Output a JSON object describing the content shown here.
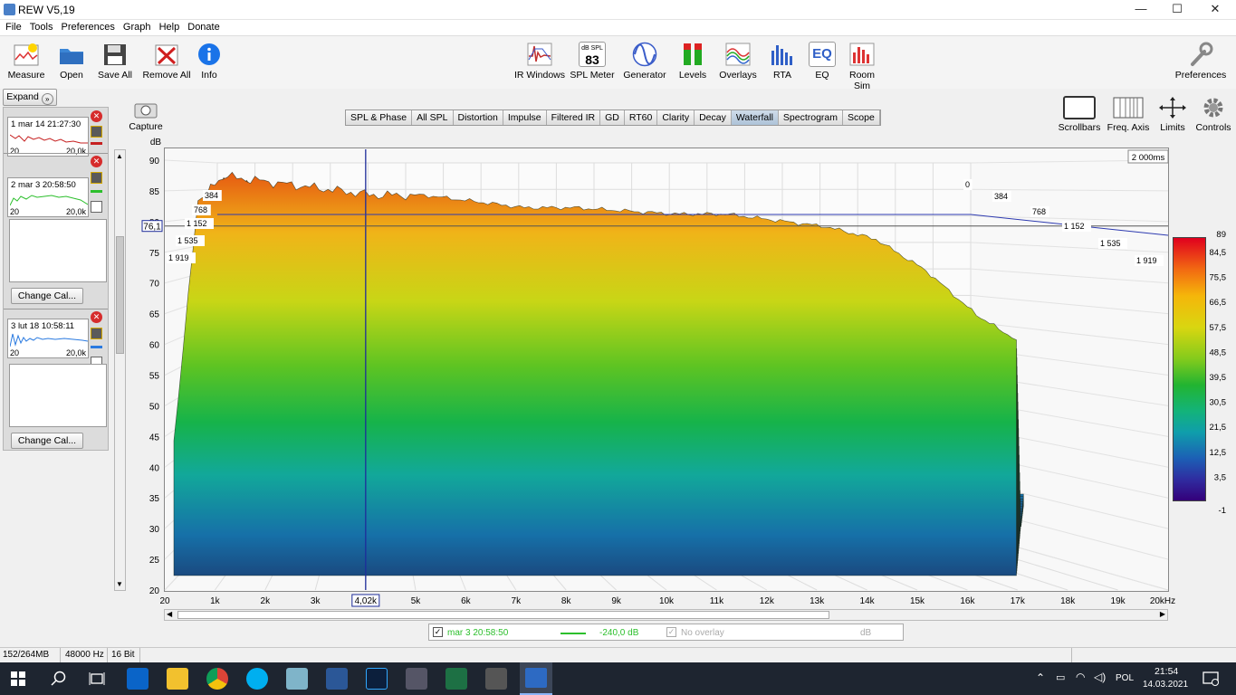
{
  "window": {
    "title": "REW V5,19",
    "minimize": "—",
    "maximize": "☐",
    "close": "✕"
  },
  "menu": [
    "File",
    "Tools",
    "Preferences",
    "Graph",
    "Help",
    "Donate"
  ],
  "toolbar_left": [
    {
      "label": "Measure",
      "icon": "measure-icon",
      "color": "#d44"
    },
    {
      "label": "Open",
      "icon": "folder-icon",
      "color": "#2f78d0"
    },
    {
      "label": "Save All",
      "icon": "floppy-icon",
      "color": "#333"
    },
    {
      "label": "Remove All",
      "icon": "remove-icon",
      "color": "#c22"
    },
    {
      "label": "Info",
      "icon": "info-icon",
      "color": "#1a73e8"
    }
  ],
  "toolbar_center": [
    {
      "label": "IR Windows",
      "icon": "ir-windows-icon"
    },
    {
      "label": "SPL Meter",
      "icon": "spl-meter-icon",
      "badge_top": "dB SPL",
      "badge_value": "83"
    },
    {
      "label": "Generator",
      "icon": "generator-icon"
    },
    {
      "label": "Levels",
      "icon": "levels-icon"
    },
    {
      "label": "Overlays",
      "icon": "overlays-icon"
    },
    {
      "label": "RTA",
      "icon": "rta-icon"
    },
    {
      "label": "EQ",
      "icon": "eq-icon",
      "badge_value": "EQ"
    },
    {
      "label": "Room Sim",
      "icon": "room-sim-icon"
    }
  ],
  "toolbar_right": {
    "label": "Preferences",
    "icon": "wrench-icon"
  },
  "graph_tools": [
    {
      "label": "Scrollbars",
      "icon": "scrollbars-icon"
    },
    {
      "label": "Freq. Axis",
      "icon": "freq-axis-icon"
    },
    {
      "label": "Limits",
      "icon": "limits-icon"
    },
    {
      "label": "Controls",
      "icon": "gear-icon"
    }
  ],
  "capture": {
    "label": "Capture",
    "icon": "camera-icon"
  },
  "expand_label": "Expand",
  "tabs": [
    "SPL & Phase",
    "All SPL",
    "Distortion",
    "Impulse",
    "Filtered IR",
    "GD",
    "RT60",
    "Clarity",
    "Decay",
    "Waterfall",
    "Spectrogram",
    "Scope"
  ],
  "selected_tab": "Waterfall",
  "measurements": [
    {
      "num": "1",
      "name": "mar 14 21:27:30",
      "fmin": "20",
      "fmax": "20,0k",
      "color": "#c62020"
    },
    {
      "num": "2",
      "name": "mar 3 20:58:50",
      "fmin": "20",
      "fmax": "20,0k",
      "color": "#2cbf2c"
    },
    {
      "num": "3",
      "name": "lut 18 10:58:11",
      "fmin": "20",
      "fmax": "20,0k",
      "color": "#2a7ae0"
    }
  ],
  "change_cal_label": "Change Cal...",
  "chart_data": {
    "type": "area",
    "subtype": "waterfall",
    "ylabel": "dB",
    "y_ticks": [
      "90",
      "85",
      "80",
      "75",
      "70",
      "65",
      "60",
      "55",
      "50",
      "45",
      "40",
      "35",
      "30",
      "25",
      "20"
    ],
    "ylim": [
      20,
      90
    ],
    "x_ticks": [
      "20",
      "1k",
      "2k",
      "3k",
      "4k",
      "5k",
      "6k",
      "7k",
      "8k",
      "9k",
      "10k",
      "11k",
      "12k",
      "13k",
      "14k",
      "15k",
      "16k",
      "17k",
      "18k",
      "19k",
      "20kHz"
    ],
    "xlim": [
      20,
      20000
    ],
    "time_labels_left": [
      "384",
      "768",
      "1 152",
      "1 535",
      "1 919"
    ],
    "time_labels_right": [
      "0",
      "384",
      "768",
      "1 152",
      "1 535",
      "1 919"
    ],
    "time_max_label": "2 000ms",
    "cursor_x_label": "4,02k",
    "cursor_y_label": "76,1",
    "colorbar_ticks": [
      "89",
      "84,5",
      "75,5",
      "66,5",
      "57,5",
      "48,5",
      "39,5",
      "30,5",
      "21,5",
      "12,5",
      "3,5",
      "-1"
    ],
    "front_slice": [
      {
        "hz": 20,
        "db": 42
      },
      {
        "hz": 500,
        "db": 80
      },
      {
        "hz": 1000,
        "db": 84
      },
      {
        "hz": 2000,
        "db": 83
      },
      {
        "hz": 3000,
        "db": 82
      },
      {
        "hz": 4000,
        "db": 81
      },
      {
        "hz": 5000,
        "db": 81
      },
      {
        "hz": 6000,
        "db": 80
      },
      {
        "hz": 7000,
        "db": 79
      },
      {
        "hz": 8000,
        "db": 79
      },
      {
        "hz": 9000,
        "db": 78.5
      },
      {
        "hz": 10000,
        "db": 78
      },
      {
        "hz": 11000,
        "db": 78
      },
      {
        "hz": 12000,
        "db": 77
      },
      {
        "hz": 13000,
        "db": 76
      },
      {
        "hz": 14000,
        "db": 74
      },
      {
        "hz": 15000,
        "db": 69
      },
      {
        "hz": 16000,
        "db": 62
      },
      {
        "hz": 16800,
        "db": 58
      }
    ],
    "back_floor_db": [
      22,
      24,
      27,
      30,
      32,
      34
    ]
  },
  "legend": {
    "name": "mar 3 20:58:50",
    "value": "-240,0 dB",
    "overlay": "No overlay",
    "unit": "dB",
    "color": "#2cbf2c"
  },
  "status": {
    "memory": "152/264MB",
    "rate": "48000 Hz",
    "bits": "16 Bit"
  },
  "taskbar": {
    "time": "21:54",
    "date": "14.03.2021",
    "lang": "POL"
  }
}
